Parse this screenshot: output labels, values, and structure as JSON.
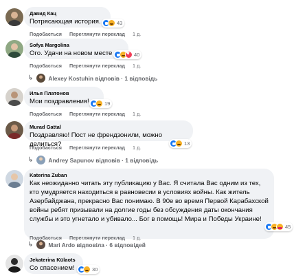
{
  "actions": {
    "like": "Подобається",
    "translate": "Переглянути переклад"
  },
  "comments": [
    {
      "author": "Давид Кац",
      "text": "Потрясающая история.",
      "reaction_count": "43",
      "time": "1 д."
    },
    {
      "author": "Sofya Margolina",
      "text": "Ого. Удачи на новом месте",
      "reaction_count": "40",
      "time": "1 д.",
      "reply": {
        "name": "Alexey Kostuhin",
        "rest": "відповів · 1 відповідь"
      }
    },
    {
      "author": "Илья Платонов",
      "text": "Мои поздравления!",
      "reaction_count": "19",
      "time": "1 д."
    },
    {
      "author": "Murad Gattal",
      "text": "Поздравляю! Пост не френдзонили, можно делиться?",
      "reaction_count": "13",
      "time": "1 д.",
      "reply": {
        "name": "Andrey Sapunov",
        "rest": "відповів · 1 відповідь"
      }
    },
    {
      "author": "Katerina Zuban",
      "text": "Как неожиданно читать эту публикацию у Вас. Я считала Вас одним из тех, кто умудряется находиться в равновесии в условиях войны. Как житель Азербайджана, прекрасно Вас понимаю. В 90е во время Первой Карабахской войны ребят призывали на долгие годы без обсуждения даты окончания службы и это угнетало и убивало... Бог в помощь! Мира и Победы Украине!",
      "reaction_count": "45",
      "time": "1 д.",
      "reply": {
        "name": "Mari Ardo",
        "rest": "відповіла · 6 відповідей"
      }
    },
    {
      "author": "Jekaterina Külaots",
      "text": "Со спасением!",
      "reaction_count": "30"
    }
  ]
}
